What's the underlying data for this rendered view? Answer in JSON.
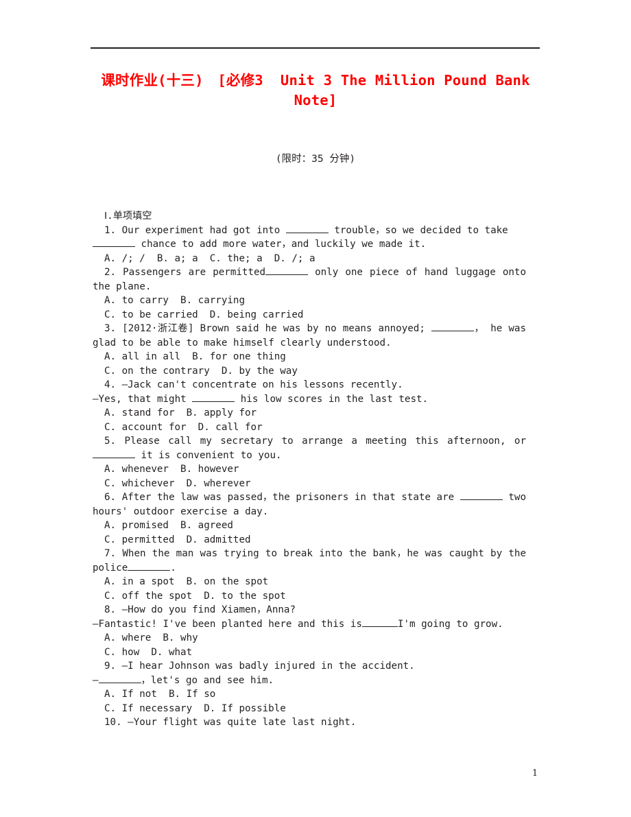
{
  "document": {
    "title_lines": [
      "课时作业(十三)　[必修3  Unit 3 The Million Pound Bank",
      "Note]"
    ],
    "title_color": "#fe0000",
    "time_limit": "(限时：35 分钟)",
    "page_number": "1"
  },
  "section": {
    "heading": "Ⅰ.单项填空"
  },
  "questions": [
    {
      "number": "1.",
      "stem_part_1": "Our experiment had got into ",
      "stem_part_2": " trouble，so we decided to take ",
      "stem_part_3": " chance to add more water，and luckily we made it.",
      "options_line_1": "A. /; /  B. a; a  C. the; a  D. /; a",
      "options_line_2": ""
    },
    {
      "number": "2.",
      "stem_part_1": "Passengers are permitted",
      "stem_part_2": " only one piece of hand luggage onto the plane.",
      "options_line_1": "A. to carry  B. carrying",
      "options_line_2": "C. to be carried  D. being carried"
    },
    {
      "number": "3.",
      "source_tag": "[2012·浙江卷] ",
      "stem_part_1": "Brown said he was by no means annoyed; ",
      "stem_part_2": "，  he was glad to be able to make himself clearly understood.",
      "options_line_1": "A. all in all  B. for one thing",
      "options_line_2": "C. on the contrary  D. by the way"
    },
    {
      "number": "4.",
      "dialogue_line_1": "—Jack can't concentrate on his lessons recently.",
      "dialogue_line_2_a": "—Yes, that might ",
      "dialogue_line_2_b": " his low scores in the last test.",
      "options_line_1": "A. stand for  B. apply for",
      "options_line_2": "C. account for  D. call for"
    },
    {
      "number": "5.",
      "stem_part_1": "Please call my secretary to arrange a meeting this afternoon, or ",
      "stem_part_2": " it is convenient to you.",
      "options_line_1": "A. whenever  B. however",
      "options_line_2": "C. whichever  D. wherever"
    },
    {
      "number": "6.",
      "stem_part_1": "After the law was passed，the prisoners in that state are ",
      "stem_part_2": " two hours' outdoor exercise a day.",
      "options_line_1": "A. promised  B. agreed",
      "options_line_2": "C. permitted  D. admitted"
    },
    {
      "number": "7.",
      "stem_part_1": "When the man was trying to break into the bank，he was caught by the police",
      "stem_part_2": ".",
      "options_line_1": "A. in a spot  B. on the spot",
      "options_line_2": "C. off the spot  D. to the spot"
    },
    {
      "number": "8.",
      "dialogue_line_1": "—How do you find Xiamen，Anna?",
      "dialogue_line_2_a": "—Fantastic! I've been planted here and this is",
      "dialogue_line_2_b": "I'm going to grow.",
      "options_line_1": "A. where  B. why",
      "options_line_2": "C. how  D. what"
    },
    {
      "number": "9.",
      "dialogue_line_1": "—I hear Johnson was badly injured in the accident.",
      "dialogue_line_2_a": "—",
      "dialogue_line_2_b": "，let's go and see him.",
      "options_line_1": "A. If not  B. If so",
      "options_line_2": "C. If necessary  D. If possible"
    },
    {
      "number": "10.",
      "dialogue_line_1": "—Your flight was quite late last night."
    }
  ]
}
